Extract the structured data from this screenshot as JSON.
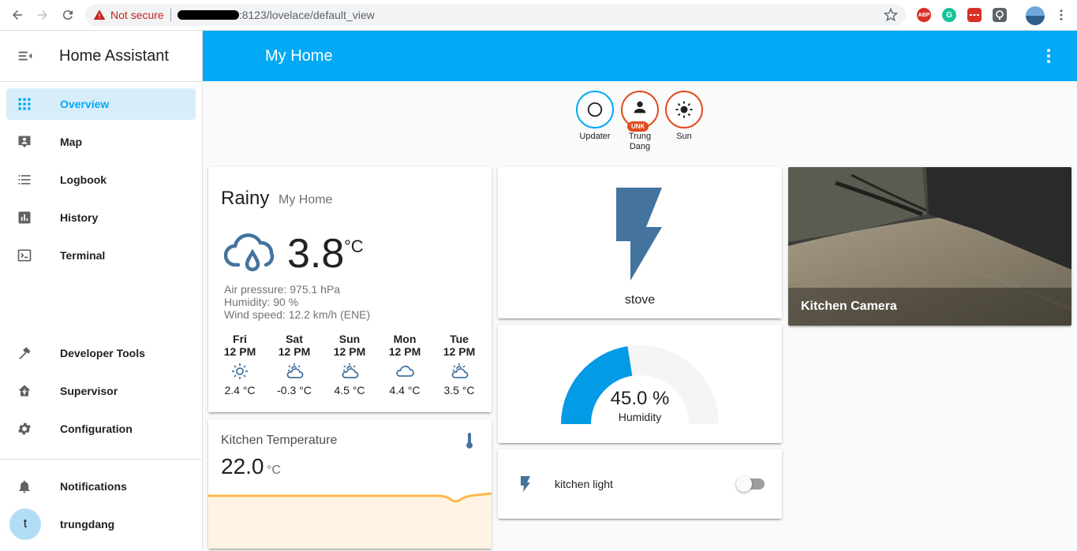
{
  "browser": {
    "security_label": "Not secure",
    "url": ":8123/lovelace/default_view",
    "extensions": [
      "ABP",
      "G"
    ]
  },
  "sidebar": {
    "title": "Home Assistant",
    "items": [
      {
        "label": "Overview",
        "icon": "grid-icon",
        "active": true
      },
      {
        "label": "Map",
        "icon": "map-icon"
      },
      {
        "label": "Logbook",
        "icon": "list-icon"
      },
      {
        "label": "History",
        "icon": "chart-icon"
      },
      {
        "label": "Terminal",
        "icon": "terminal-icon"
      }
    ],
    "tools": [
      {
        "label": "Developer Tools",
        "icon": "hammer-icon"
      },
      {
        "label": "Supervisor",
        "icon": "supervisor-icon"
      },
      {
        "label": "Configuration",
        "icon": "gear-icon"
      }
    ],
    "notifications_label": "Notifications",
    "user": {
      "initial": "t",
      "name": "trungdang"
    }
  },
  "header": {
    "title": "My Home"
  },
  "badges": [
    {
      "label": "Updater",
      "icon": "circle-icon",
      "color": "#03a9f4"
    },
    {
      "label": "Trung Dang",
      "icon": "person-icon",
      "color": "#df4c1e",
      "status": "UNK"
    },
    {
      "label": "Sun",
      "icon": "sun-icon",
      "color": "#df4c1e"
    }
  ],
  "weather": {
    "condition": "Rainy",
    "name": "My Home",
    "temperature": "3.8",
    "unit": "°C",
    "attributes": [
      "Air pressure: 975.1 hPa",
      "Humidity: 90 %",
      "Wind speed: 12.2 km/h (ENE)"
    ],
    "forecast": [
      {
        "day": "Fri",
        "time": "12 PM",
        "icon": "sunny-icon",
        "temp": "2.4 °C"
      },
      {
        "day": "Sat",
        "time": "12 PM",
        "icon": "partly-cloudy-icon",
        "temp": "-0.3 °C"
      },
      {
        "day": "Sun",
        "time": "12 PM",
        "icon": "partly-cloudy-icon",
        "temp": "4.5 °C"
      },
      {
        "day": "Mon",
        "time": "12 PM",
        "icon": "cloudy-icon",
        "temp": "4.4 °C"
      },
      {
        "day": "Tue",
        "time": "12 PM",
        "icon": "partly-cloudy-icon",
        "temp": "3.5 °C"
      }
    ]
  },
  "stove": {
    "label": "stove",
    "icon": "flash-icon",
    "color": "#44739e"
  },
  "camera": {
    "caption": "Kitchen Camera"
  },
  "gauge": {
    "value_text": "45.0 %",
    "label": "Humidity",
    "value": 45,
    "min": 0,
    "max": 100,
    "color": "#039be5"
  },
  "kitchen_light": {
    "name": "kitchen light",
    "icon": "flash-icon",
    "state": "off"
  },
  "kitchen_temp": {
    "name": "Kitchen Temperature",
    "value": "22.0",
    "unit": "°C",
    "icon": "thermometer-icon",
    "line_color": "#ffb74d"
  }
}
